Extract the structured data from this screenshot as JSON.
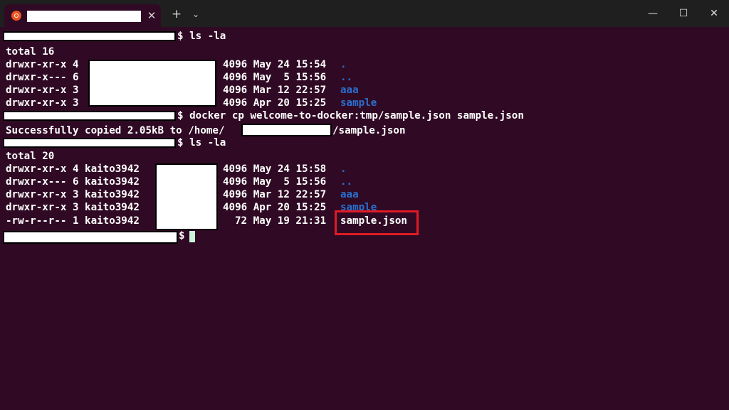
{
  "window": {
    "tab_close_glyph": "✕",
    "new_tab_glyph": "+",
    "dropdown_glyph": "⌄",
    "minimize_glyph": "—",
    "maximize_glyph": "☐",
    "close_glyph": "✕",
    "accent_color": "#e95420",
    "terminal_bg": "#300a24"
  },
  "terminal": {
    "cmd1": "$ ls -la",
    "l_total16": "total 16",
    "l1_perm": "drwxr-xr-x 4",
    "l1_rest": "4096 May 24 15:54",
    "l1_name": ".",
    "l2_perm": "drwxr-x--- 6",
    "l2_rest": "4096 May  5 15:56",
    "l2_name": "..",
    "l3_perm": "drwxr-xr-x 3",
    "l3_rest": "4096 Mar 12 22:57",
    "l3_name": "aaa",
    "l4_perm": "drwxr-xr-x 3",
    "l4_rest": "4096 Apr 20 15:25",
    "l4_name": "sample",
    "cmd2": "$ docker cp welcome-to-docker:tmp/sample.json sample.json",
    "copied_prefix": "Successfully copied 2.05kB to /home/",
    "copied_suffix": "/sample.json",
    "cmd3": "$ ls -la",
    "l_total20": "total 20",
    "m1_perm": "drwxr-xr-x 4 kaito3942",
    "m1_rest": "4096 May 24 15:58",
    "m1_name": ".",
    "m2_perm": "drwxr-x--- 6 kaito3942",
    "m2_rest": "4096 May  5 15:56",
    "m2_name": "..",
    "m3_perm": "drwxr-xr-x 3 kaito3942",
    "m3_rest": "4096 Mar 12 22:57",
    "m3_name": "aaa",
    "m4_perm": "drwxr-xr-x 3 kaito3942",
    "m4_rest": "4096 Apr 20 15:25",
    "m4_name": "sample",
    "m5_perm": "-rw-r--r-- 1 kaito3942",
    "m5_rest": "72 May 19 21:31",
    "m5_name": "sample.json",
    "prompt_end": "$",
    "highlight_color": "#e01b24"
  }
}
